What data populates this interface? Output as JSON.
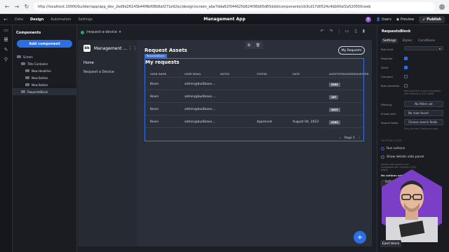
{
  "browser": {
    "url": "http://localhost:10000/builder/app/app_dev_2ed9d26143b44f8bf08b6af271e92ec/design/screen_abe7dda62f344625b624f36b65d65ddd/components/cb3cd17d0524c4db00af2a520550ceeb"
  },
  "topbar": {
    "tabs": [
      "Data",
      "Design",
      "Automation",
      "Settings"
    ],
    "active_tab": "Design",
    "app_title": "Management App",
    "user_initial": "K",
    "users_label": "Users",
    "preview_label": "Preview",
    "publish_label": "Publish"
  },
  "left_panel": {
    "title": "Components",
    "add_button": "Add component",
    "tree": [
      {
        "label": "Screen",
        "level": 0
      },
      {
        "label": "Title Container",
        "level": 1
      },
      {
        "label": "New Headline",
        "level": 2
      },
      {
        "label": "New Button",
        "level": 2
      },
      {
        "label": "New Button",
        "level": 2
      },
      {
        "label": "RequestsBlock",
        "level": 1,
        "selected": true
      }
    ]
  },
  "canvas": {
    "device_selector": "/request-a-device",
    "app": {
      "logo_text": "bb",
      "name": "Management ...",
      "nav": [
        "Home",
        "Request a Device"
      ]
    },
    "page_title": "Request Assets",
    "my_requests_button": "My Requests",
    "selection_tag": "RequestsBlock",
    "table": {
      "title": "My requests",
      "columns": [
        "USER NAME",
        "USER EMAIL",
        "NOTES",
        "STATUS",
        "DATE",
        "ASSETSTHEUSERREQUESTED"
      ],
      "rows": [
        {
          "name": "Kevin",
          "email": "admin@budibase....",
          "notes": "",
          "status": "",
          "date": "",
          "asset": "2565"
        },
        {
          "name": "Kevin",
          "email": "admin@budibase....",
          "notes": "",
          "status": "",
          "date": "",
          "asset": "187"
        },
        {
          "name": "Kevin",
          "email": "admin@budibase....",
          "notes": "",
          "status": "",
          "date": "",
          "asset": "4829"
        },
        {
          "name": "Kevin",
          "email": "admin@budibase....",
          "notes": "",
          "status": "Approved",
          "date": "August 04, 2023",
          "asset": "2283"
        }
      ],
      "pagination": {
        "prev": "‹",
        "label": "Page 1",
        "next": "›"
      }
    },
    "fab_label": "+"
  },
  "right_panel": {
    "title": "RequestsBlock",
    "tabs": [
      "Settings",
      "Styles",
      "Conditions"
    ],
    "active_tab": "Settings",
    "props": {
      "row_limit_label": "Row limit",
      "paginate_label": "Paginate",
      "quiet_label": "Quiet",
      "compact_label": "Compact",
      "row_selection_label": "Row selection",
      "row_selection_hint": "Row selection is only compatible with internal or SQL tables",
      "filtering_label": "Filtering",
      "filtering_value": "No filters set",
      "empty_text_label": "Empty text",
      "empty_text_value": "No rows found",
      "search_fields_label": "Search fields",
      "search_fields_value": "Choose search fields",
      "search_fields_hint": "Only the first 5 fields are used"
    },
    "on_row_click": {
      "section": "ON ROW CLICK",
      "options": [
        "Run actions",
        "Show details side panel"
      ],
      "selected": "Run actions",
      "hint": "Details side panel is only compatible with internal or SQL tables",
      "actions_label": "No actions set",
      "define_label": "Define actions"
    },
    "eject_label": "Eject block"
  },
  "colors": {
    "accent": "#2d6fe3",
    "background": "#1c1f26",
    "selection": "#3b6fd9"
  }
}
